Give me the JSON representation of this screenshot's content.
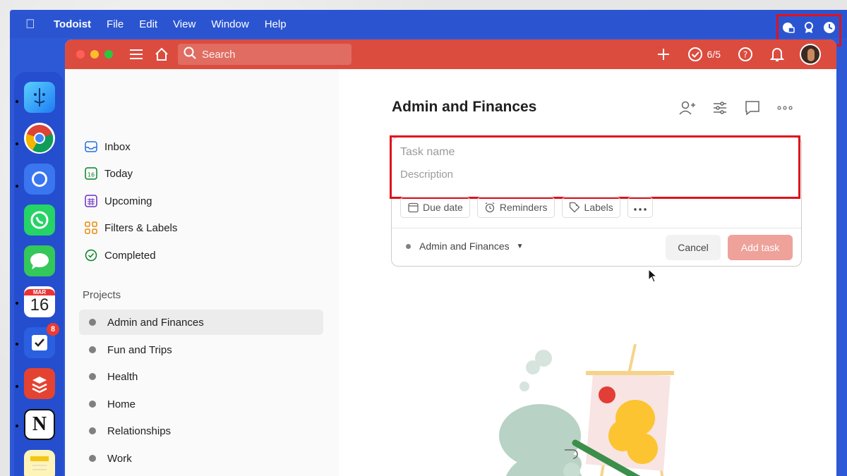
{
  "menubar": {
    "app_name": "Todoist",
    "items": [
      "File",
      "Edit",
      "View",
      "Window",
      "Help"
    ]
  },
  "dock": {
    "calendar_month": "MAR",
    "calendar_day": "16",
    "tasks_badge": "8"
  },
  "topbar": {
    "search_placeholder": "Search",
    "productivity": "6/5"
  },
  "sidebar": {
    "nav": [
      {
        "label": "Inbox",
        "icon": "inbox-icon"
      },
      {
        "label": "Today",
        "icon": "today-icon",
        "day": "16"
      },
      {
        "label": "Upcoming",
        "icon": "calendar-icon"
      },
      {
        "label": "Filters & Labels",
        "icon": "filters-icon"
      },
      {
        "label": "Completed",
        "icon": "check-circle-icon"
      }
    ],
    "projects_heading": "Projects",
    "projects": [
      "Admin and Finances",
      "Fun and Trips",
      "Health",
      "Home",
      "Relationships",
      "Work"
    ]
  },
  "main": {
    "title": "Admin and Finances",
    "editor": {
      "task_placeholder": "Task name",
      "description_placeholder": "Description",
      "chips": [
        "Due date",
        "Reminders",
        "Labels"
      ],
      "project": "Admin and Finances",
      "cancel_label": "Cancel",
      "add_label": "Add task"
    }
  },
  "colors": {
    "brand_red": "#db4c3f",
    "highlight": "#e0121b",
    "desktop_blue": "#2e59d6"
  }
}
